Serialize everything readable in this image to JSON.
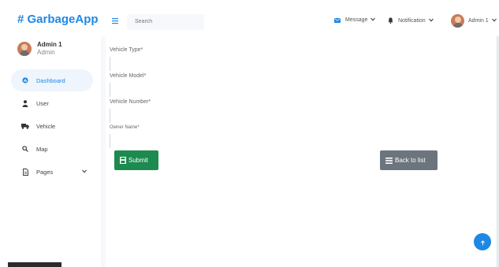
{
  "app": {
    "brand": "# GarbageApp"
  },
  "profile": {
    "name": "Admin 1",
    "role": "Admin"
  },
  "sidebar": {
    "items": [
      {
        "label": "Dashboard",
        "icon": "dashboard-icon",
        "active": true
      },
      {
        "label": "User",
        "icon": "user-icon"
      },
      {
        "label": "Vehicle",
        "icon": "truck-icon"
      },
      {
        "label": "Map",
        "icon": "map-search-icon"
      },
      {
        "label": "Pages",
        "icon": "document-icon",
        "has_caret": true
      }
    ]
  },
  "header": {
    "search_placeholder": "Search",
    "message_label": "Message",
    "notification_label": "Notification",
    "user_label": "Admin 1"
  },
  "form": {
    "fields": [
      {
        "label": "Vehicle Type*"
      },
      {
        "label": "Vehicle Model*"
      },
      {
        "label": "Vehicle Number*"
      },
      {
        "label": "Owner Name*"
      }
    ],
    "submit_label": "Submit",
    "back_label": "Back to list"
  },
  "colors": {
    "brand": "#1e88e5",
    "submit": "#1d8a4f",
    "back": "#6c757d",
    "content_bg": "#f6f8fb"
  }
}
